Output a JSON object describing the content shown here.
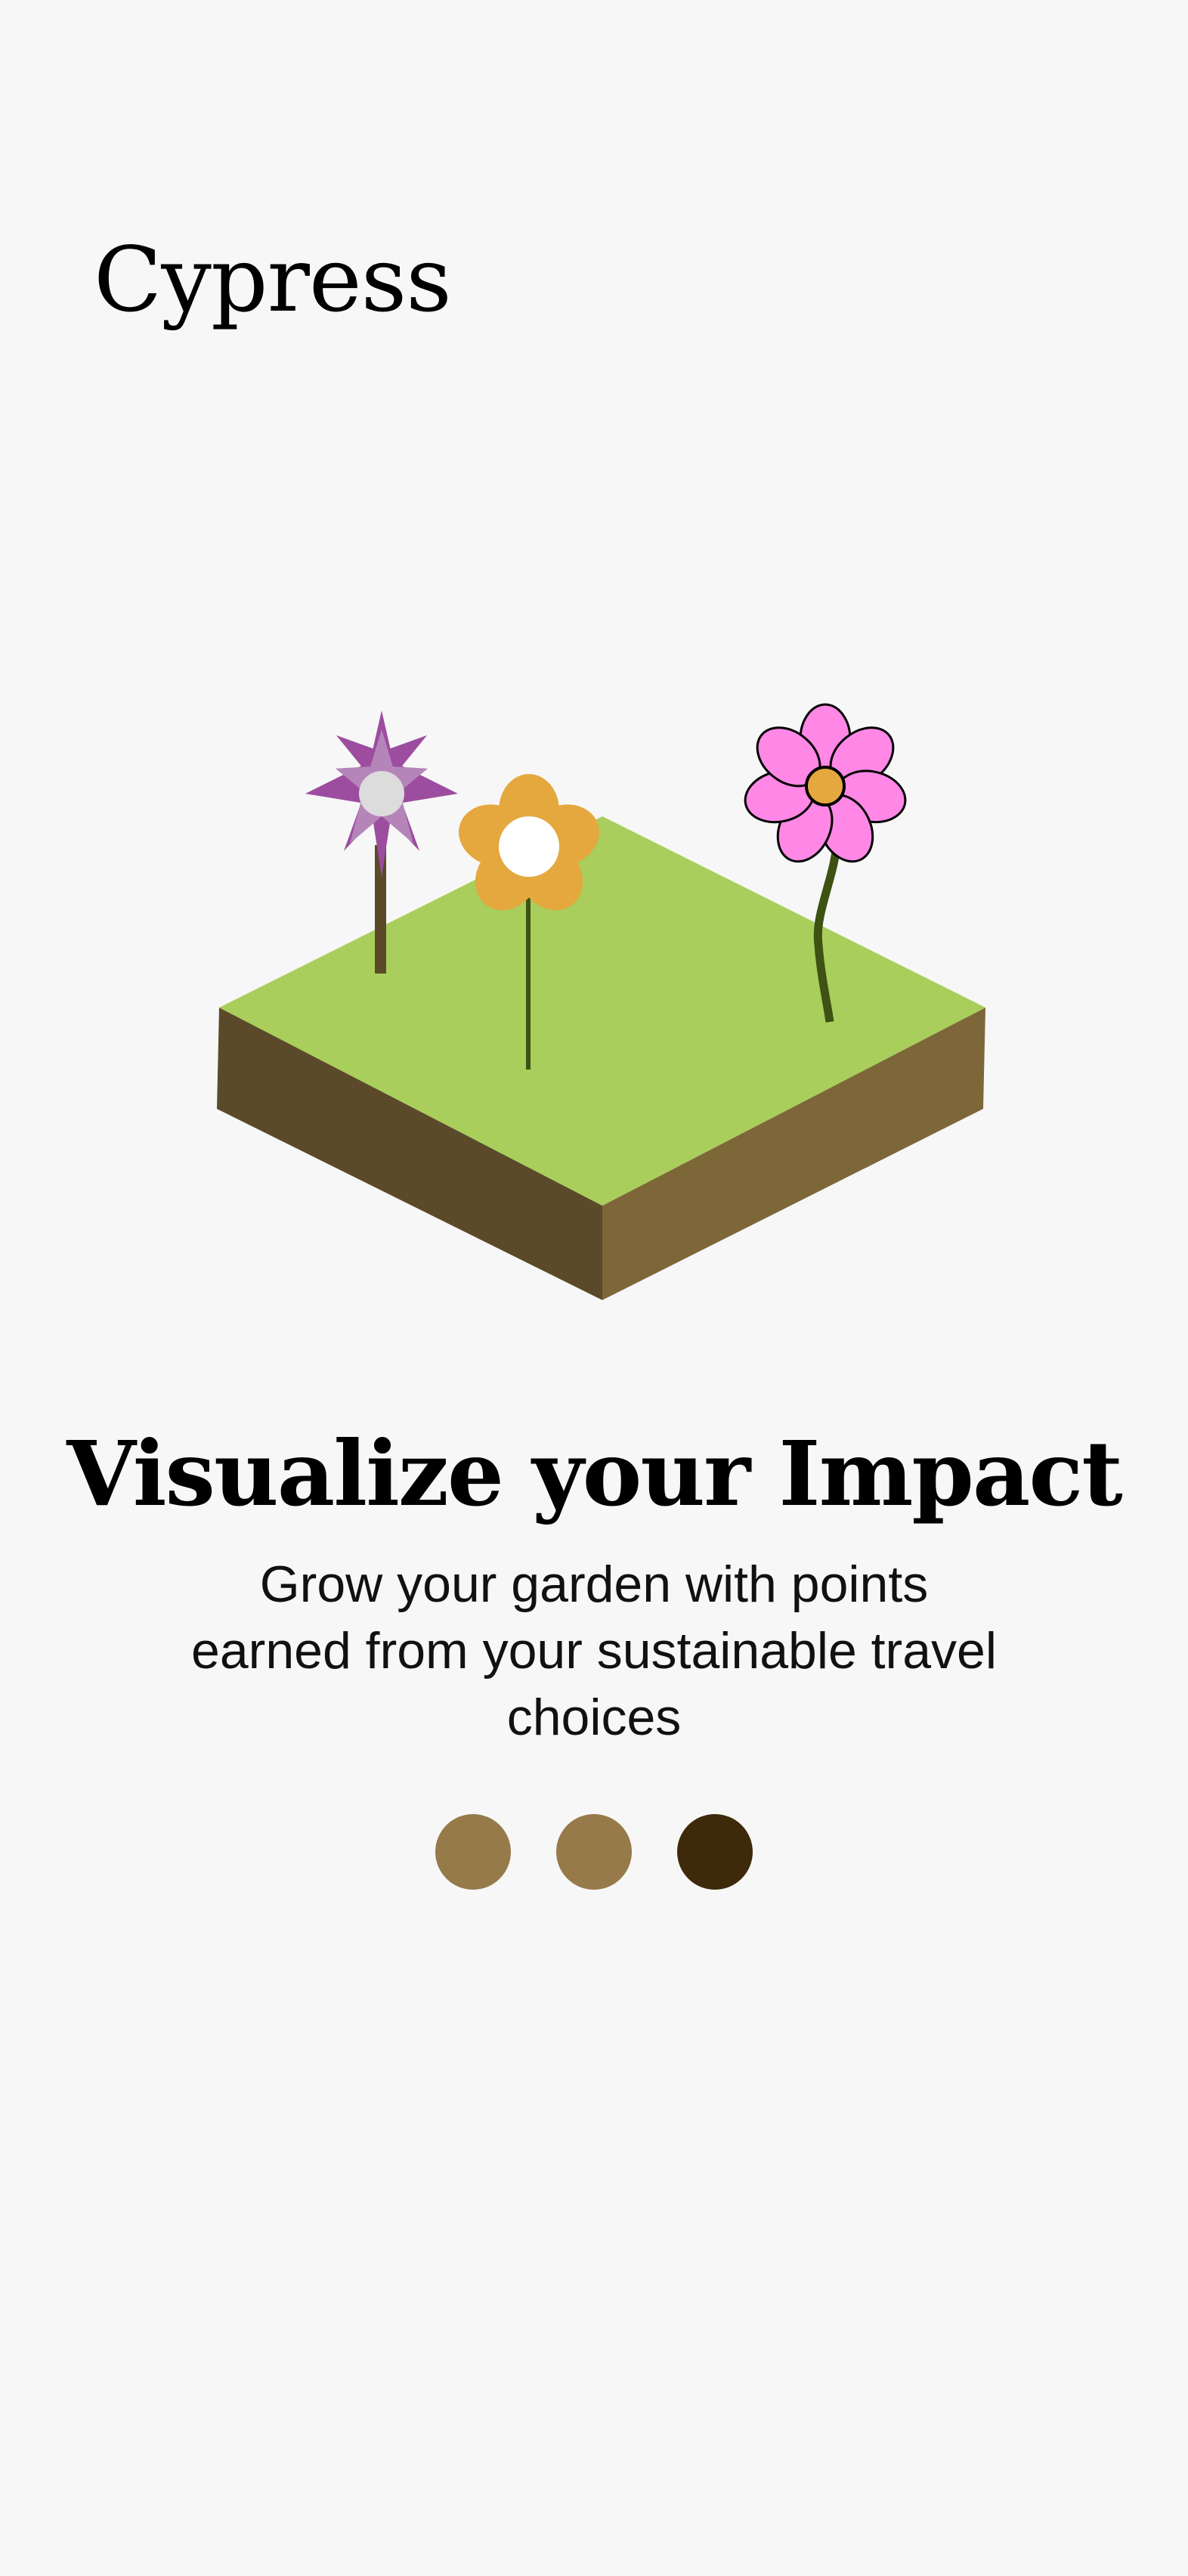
{
  "app": {
    "title": "Cypress"
  },
  "onboarding": {
    "headline": "Visualize your Impact",
    "description": "Grow your garden with points earned from your sustainable travel choices"
  },
  "illustration": {
    "icon": "garden-island-illustration",
    "colors": {
      "grass": "#a9ce5c",
      "soil_left": "#5b4a2a",
      "soil_right": "#7d6739",
      "star_flower": "#a25aa9",
      "orange_flower": "#e4a83e",
      "pink_flower": "#ff88e6"
    }
  },
  "pagination": {
    "total": 3,
    "active_index": 2,
    "active_color": "#3e2a0a",
    "inactive_color": "#967a49"
  }
}
